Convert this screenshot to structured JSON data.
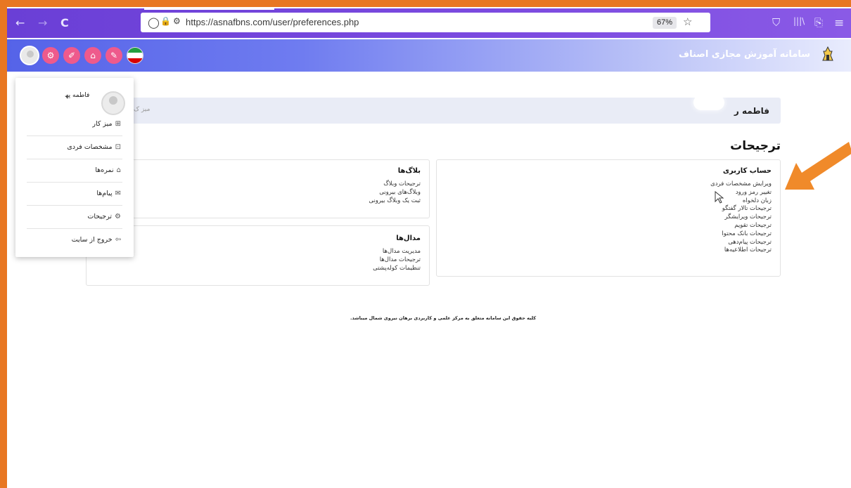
{
  "browser": {
    "url": "https://asnafbns.com/user/preferences.php",
    "zoom": "67%",
    "back": "←",
    "forward": "→",
    "reload": "C",
    "shield": "◯",
    "lock": "🔒",
    "tune": "⚙",
    "star": "☆",
    "pocket": "⛉",
    "library": "|||\\",
    "extensions": "⎘",
    "menu": "≡"
  },
  "header": {
    "site_title": "سامانه آموزش مجازی اصناف",
    "buttons": [
      "⚙",
      "✐",
      "⌂",
      "✎"
    ],
    "flag_colors": [
      "#239f40",
      "#ffffff",
      "#da0000"
    ]
  },
  "dropdown": {
    "user_name": "فاطمه پھ",
    "items": [
      {
        "label": "میز کار",
        "icon": "⊞"
      },
      {
        "label": "مشخصات فردی",
        "icon": "⊡"
      },
      {
        "label": "نمره‌ها",
        "icon": "⌂"
      },
      {
        "label": "پیام‌ها",
        "icon": "✉"
      },
      {
        "label": "ترجیحات",
        "icon": "⚙"
      },
      {
        "label": "خروج از سایت",
        "icon": "⇦"
      }
    ]
  },
  "user_bar": {
    "name": "فاطمه ر",
    "left_text": "میز ک"
  },
  "page_title": "ترجیحات",
  "cards": {
    "account": {
      "title": "حساب کاربری",
      "links": [
        "ویرایش مشخصات فردی",
        "تغییر رمز ورود",
        "زبان دلخواه",
        "ترجیحات تالار گفتگو",
        "ترجیحات ویرایشگر",
        "ترجیحات تقویم",
        "ترجیحات بانک محتوا",
        "ترجیحات پیام‌دهی",
        "ترجیحات اطلاعیه‌ها"
      ]
    },
    "blogs": {
      "title": "بلاگ‌ها",
      "links": [
        "ترجیحات وبلاگ",
        "وبلاگ‌های بیرونی",
        "ثبت یک وبلاگ بیرونی"
      ]
    },
    "badges": {
      "title": "مدال‌ها",
      "links": [
        "مدیریت مدال‌ها",
        "ترجیحات مدال‌ها",
        "تنظیمات کوله‌پشتی"
      ]
    }
  },
  "footer": "کلیه حقوق این سامانه متعلق به مرکز علمی و کاربردی برهان نیروی شمال میباشد.",
  "colors": {
    "accent_orange": "#e87722",
    "pink_button": "#ee5a8c",
    "browser_purple": "#7c4be0"
  }
}
